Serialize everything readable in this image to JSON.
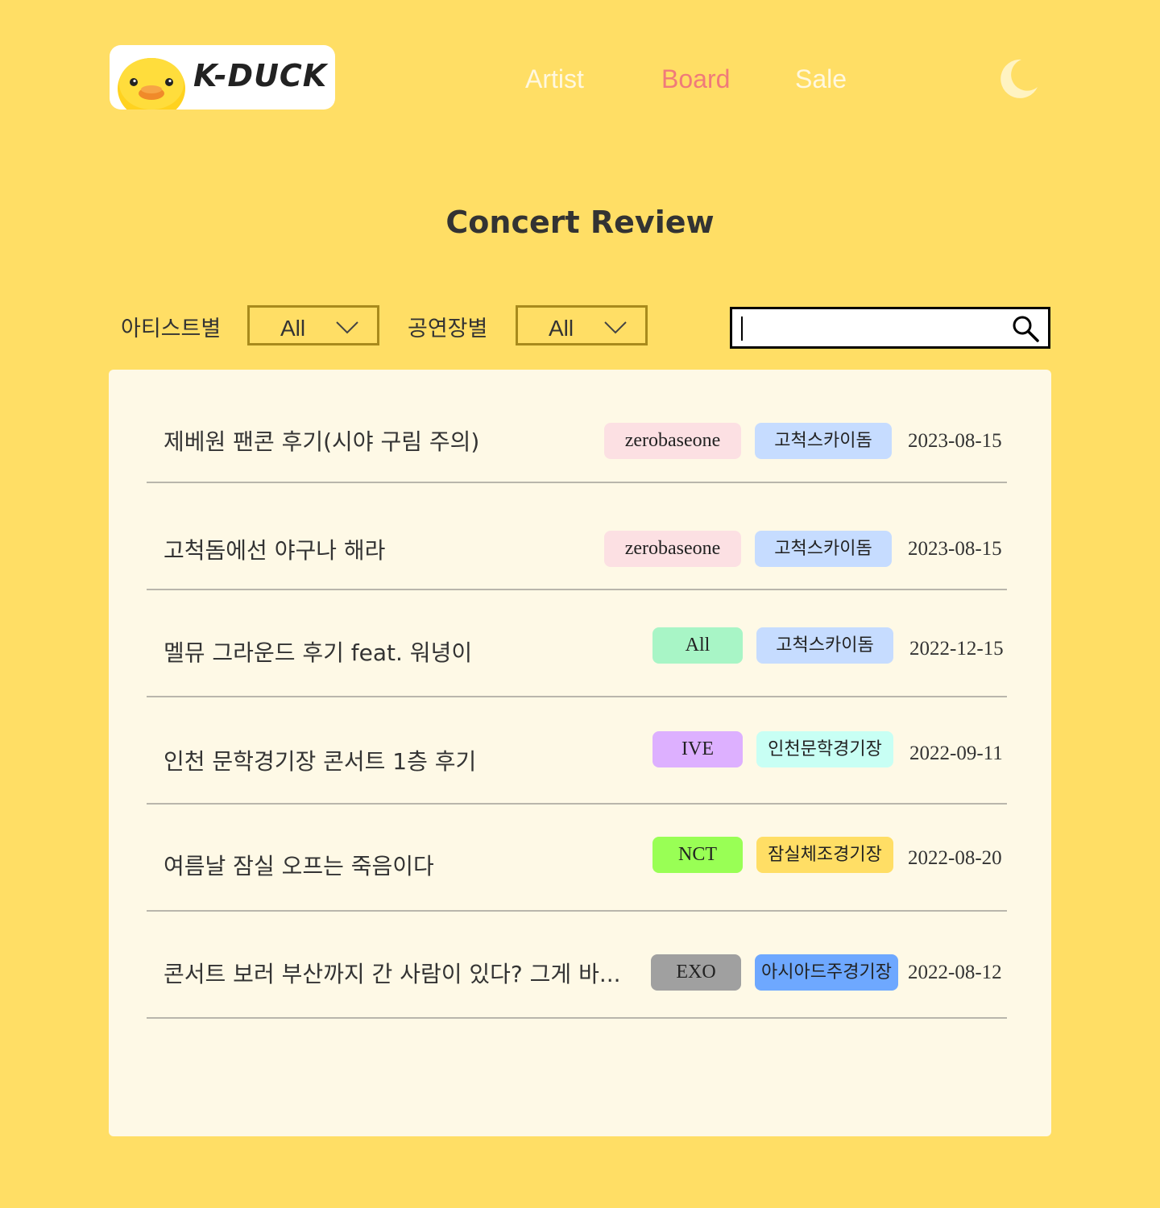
{
  "header": {
    "logo_text": "K-DUCK",
    "nav": [
      {
        "label": "Artist",
        "active": false
      },
      {
        "label": "Board",
        "active": true
      },
      {
        "label": "Sale",
        "active": false
      }
    ],
    "theme_icon": "moon-icon"
  },
  "page_title": "Concert Review",
  "filters": {
    "artist_label": "아티스트별",
    "artist_value": "All",
    "venue_label": "공연장별",
    "venue_value": "All",
    "search_value": "",
    "search_icon": "search-icon"
  },
  "colors": {
    "background": "#FFDE65",
    "nav_default": "#FFF8E0",
    "nav_active": "#F07A7A",
    "board_bg": "#FEF9E6"
  },
  "reviews": [
    {
      "title": "제베원 팬콘 후기(시야 구림 주의)",
      "artist": "zerobaseone",
      "artist_color": "#FCE0E3",
      "venue": "고척스카이돔",
      "venue_color": "#C6DCFF",
      "date": "2023-08-15"
    },
    {
      "title": "고척돔에선 야구나 해라",
      "artist": "zerobaseone",
      "artist_color": "#FCE0E3",
      "venue": "고척스카이돔",
      "venue_color": "#C6DCFF",
      "date": "2023-08-15"
    },
    {
      "title": "멜뮤 그라운드 후기 feat. 워녕이",
      "artist": "All",
      "artist_color": "#A8F5C6",
      "venue": "고척스카이돔",
      "venue_color": "#C6DCFF",
      "date": "2022-12-15"
    },
    {
      "title": "인천 문학경기장 콘서트 1층 후기",
      "artist": "IVE",
      "artist_color": "#DDB0FF",
      "venue": "인천문학경기장",
      "venue_color": "#C8FFF4",
      "date": "2022-09-11"
    },
    {
      "title": "여름날 잠실 오프는 죽음이다",
      "artist": "NCT",
      "artist_color": "#99FF55",
      "venue": "잠실체조경기장",
      "venue_color": "#FFDE65",
      "date": "2022-08-20"
    },
    {
      "title": "콘서트 보러 부산까지 간 사람이 있다? 그게 바...",
      "artist": "EXO",
      "artist_color": "#A0A0A0",
      "venue": "아시아드주경기장",
      "venue_color": "#6EA8FF",
      "date": "2022-08-12"
    }
  ]
}
